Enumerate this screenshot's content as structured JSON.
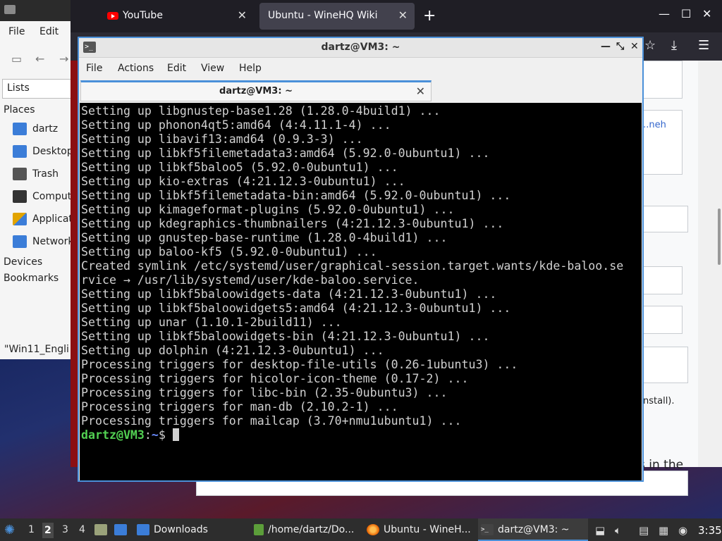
{
  "file_manager": {
    "menu": [
      "File",
      "Edit"
    ],
    "location_mode": "Lists",
    "places_heading": "Places",
    "places": [
      {
        "label": "dartz",
        "icon": "home-folder-icon",
        "color": "#3b7dd8"
      },
      {
        "label": "Desktop",
        "icon": "desktop-folder-icon",
        "color": "#3b7dd8"
      },
      {
        "label": "Trash",
        "icon": "trash-icon",
        "color": "#555555"
      },
      {
        "label": "Computer",
        "icon": "computer-icon",
        "color": "#333333"
      },
      {
        "label": "Applications",
        "icon": "applications-icon",
        "color": "#e2a400"
      },
      {
        "label": "Network",
        "icon": "network-icon",
        "color": "#3b7dd8"
      }
    ],
    "devices_heading": "Devices",
    "bookmarks_heading": "Bookmarks",
    "status_text": "\"Win11_Engli"
  },
  "browser": {
    "tabs": [
      {
        "label": "YouTube",
        "icon": "youtube-icon"
      },
      {
        "label": "Ubuntu - WineHQ Wiki",
        "icon": ""
      }
    ],
    "new_tab": "+",
    "page_fragments": {
      "link_fragment": "...neh",
      "install_fragment": "nstall).",
      "bottom_fragment": "s in the"
    }
  },
  "terminal": {
    "window_title": "dartz@VM3: ~",
    "menu": [
      "File",
      "Actions",
      "Edit",
      "View",
      "Help"
    ],
    "tab_title": "dartz@VM3: ~",
    "lines": [
      "Setting up libgnustep-base1.28 (1.28.0-4build1) ...",
      "Setting up phonon4qt5:amd64 (4:4.11.1-4) ...",
      "Setting up libavif13:amd64 (0.9.3-3) ...",
      "Setting up libkf5filemetadata3:amd64 (5.92.0-0ubuntu1) ...",
      "Setting up libkf5baloo5 (5.92.0-0ubuntu1) ...",
      "Setting up kio-extras (4:21.12.3-0ubuntu1) ...",
      "Setting up libkf5filemetadata-bin:amd64 (5.92.0-0ubuntu1) ...",
      "Setting up kimageformat-plugins (5.92.0-0ubuntu1) ...",
      "Setting up kdegraphics-thumbnailers (4:21.12.3-0ubuntu1) ...",
      "Setting up gnustep-base-runtime (1.28.0-4build1) ...",
      "Setting up baloo-kf5 (5.92.0-0ubuntu1) ...",
      "Created symlink /etc/systemd/user/graphical-session.target.wants/kde-baloo.se",
      "rvice → /usr/lib/systemd/user/kde-baloo.service.",
      "Setting up libkf5baloowidgets-data (4:21.12.3-0ubuntu1) ...",
      "Setting up libkf5baloowidgets5:amd64 (4:21.12.3-0ubuntu1) ...",
      "Setting up unar (1.10.1-2build11) ...",
      "Setting up libkf5baloowidgets-bin (4:21.12.3-0ubuntu1) ...",
      "Setting up dolphin (4:21.12.3-0ubuntu1) ...",
      "Processing triggers for desktop-file-utils (0.26-1ubuntu3) ...",
      "Processing triggers for hicolor-icon-theme (0.17-2) ...",
      "Processing triggers for libc-bin (2.35-0ubuntu3) ...",
      "Processing triggers for man-db (2.10.2-1) ...",
      "Processing triggers for mailcap (3.70+nmu1ubuntu1) ..."
    ],
    "prompt_user": "dartz@VM3",
    "prompt_sep": ":",
    "prompt_path": "~",
    "prompt_symbol": "$ "
  },
  "taskbar": {
    "workspaces": [
      "1",
      "2",
      "3",
      "4"
    ],
    "active_workspace": "2",
    "tasks": [
      {
        "label": "Downloads",
        "icon": "folder-icon"
      },
      {
        "label": "/home/dartz/Do...",
        "icon": "archive-icon"
      },
      {
        "label": "Ubuntu - WineH...",
        "icon": "firefox-icon"
      },
      {
        "label": "dartz@VM3: ~",
        "icon": "terminal-icon"
      }
    ],
    "clock": "3:35"
  }
}
